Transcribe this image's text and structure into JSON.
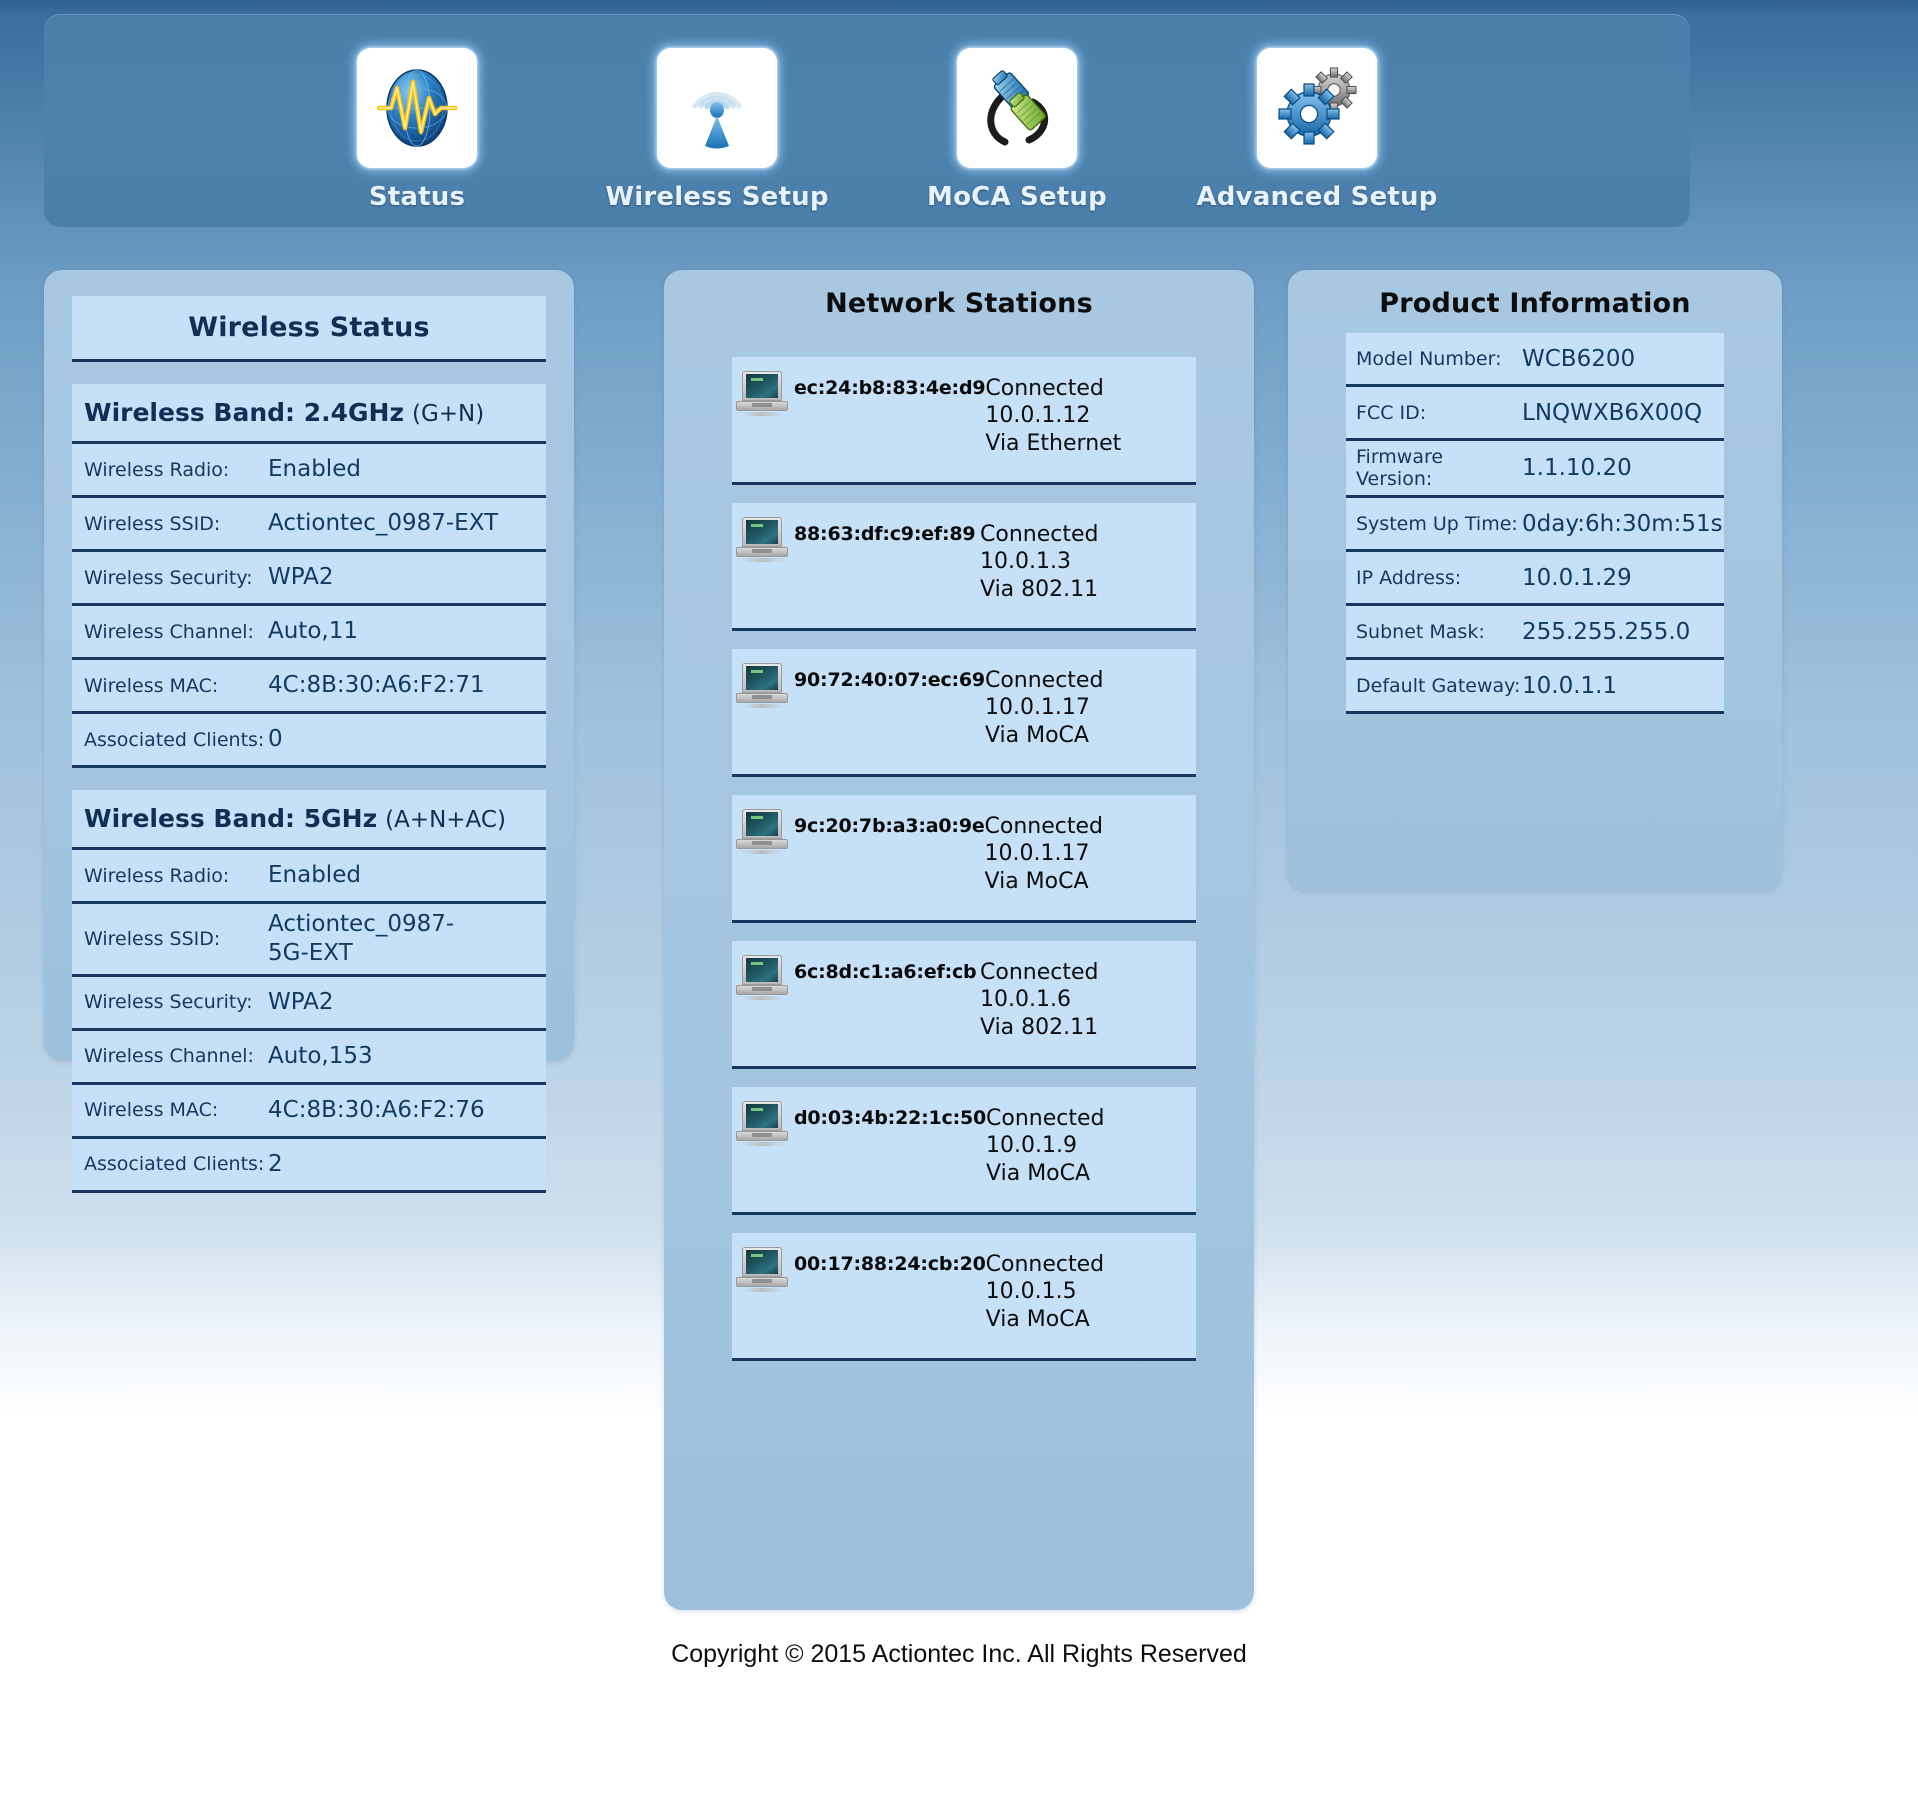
{
  "nav": {
    "items": [
      {
        "label": "Status",
        "icon": "status-globe-icon"
      },
      {
        "label": "Wireless Setup",
        "icon": "wireless-signal-icon"
      },
      {
        "label": "MoCA Setup",
        "icon": "coax-cable-icon"
      },
      {
        "label": "Advanced Setup",
        "icon": "gears-icon"
      }
    ]
  },
  "wireless_status": {
    "title": "Wireless Status",
    "bands": [
      {
        "name": "Wireless Band: 2.4GHz",
        "modes": "(G+N)",
        "rows": [
          {
            "key": "Wireless Radio:",
            "value": "Enabled"
          },
          {
            "key": "Wireless SSID:",
            "value": "Actiontec_0987-EXT"
          },
          {
            "key": "Wireless Security:",
            "value": "WPA2"
          },
          {
            "key": "Wireless Channel:",
            "value": "Auto,11"
          },
          {
            "key": "Wireless MAC:",
            "value": "4C:8B:30:A6:F2:71"
          },
          {
            "key": "Associated Clients:",
            "value": "0"
          }
        ]
      },
      {
        "name": "Wireless Band: 5GHz",
        "modes": "(A+N+AC)",
        "rows": [
          {
            "key": "Wireless Radio:",
            "value": "Enabled"
          },
          {
            "key": "Wireless SSID:",
            "value": "Actiontec_0987-5G-EXT"
          },
          {
            "key": "Wireless Security:",
            "value": "WPA2"
          },
          {
            "key": "Wireless Channel:",
            "value": "Auto,153"
          },
          {
            "key": "Wireless MAC:",
            "value": "4C:8B:30:A6:F2:76"
          },
          {
            "key": "Associated Clients:",
            "value": "2"
          }
        ]
      }
    ]
  },
  "network_stations": {
    "title": "Network Stations",
    "stations": [
      {
        "mac": "ec:24:b8:83:4e:d9",
        "status": "Connected",
        "ip": "10.0.1.12",
        "via": "Via Ethernet",
        "icon": "computer-icon"
      },
      {
        "mac": "88:63:df:c9:ef:89",
        "status": "Connected",
        "ip": "10.0.1.3",
        "via": "Via 802.11",
        "icon": "computer-icon"
      },
      {
        "mac": "90:72:40:07:ec:69",
        "status": "Connected",
        "ip": "10.0.1.17",
        "via": "Via MoCA",
        "icon": "computer-icon"
      },
      {
        "mac": "9c:20:7b:a3:a0:9e",
        "status": "Connected",
        "ip": "10.0.1.17",
        "via": "Via MoCA",
        "icon": "computer-icon"
      },
      {
        "mac": "6c:8d:c1:a6:ef:cb",
        "status": "Connected",
        "ip": "10.0.1.6",
        "via": "Via 802.11",
        "icon": "computer-icon"
      },
      {
        "mac": "d0:03:4b:22:1c:50",
        "status": "Connected",
        "ip": "10.0.1.9",
        "via": "Via MoCA",
        "icon": "computer-icon"
      },
      {
        "mac": "00:17:88:24:cb:20",
        "status": "Connected",
        "ip": "10.0.1.5",
        "via": "Via MoCA",
        "icon": "computer-icon"
      }
    ]
  },
  "product_information": {
    "title": "Product Information",
    "rows": [
      {
        "key": "Model Number:",
        "value": "WCB6200"
      },
      {
        "key": "FCC ID:",
        "value": "LNQWXB6X00Q"
      },
      {
        "key": "Firmware Version:",
        "value": "1.1.10.20"
      },
      {
        "key": "System Up Time:",
        "value": "0day:6h:30m:51s"
      },
      {
        "key": "IP Address:",
        "value": "10.0.1.29"
      },
      {
        "key": "Subnet Mask:",
        "value": "255.255.255.0"
      },
      {
        "key": "Default Gateway:",
        "value": "10.0.1.1"
      }
    ]
  },
  "footer": {
    "copyright": "Copyright © 2015 Actiontec Inc. All Rights Reserved"
  },
  "colors": {
    "header_bar": "#4a7fac",
    "panel_bg": "#a8c8e2",
    "row_bg": "#c5e0f7",
    "row_border": "#17375e",
    "value_text": "#123b63"
  }
}
